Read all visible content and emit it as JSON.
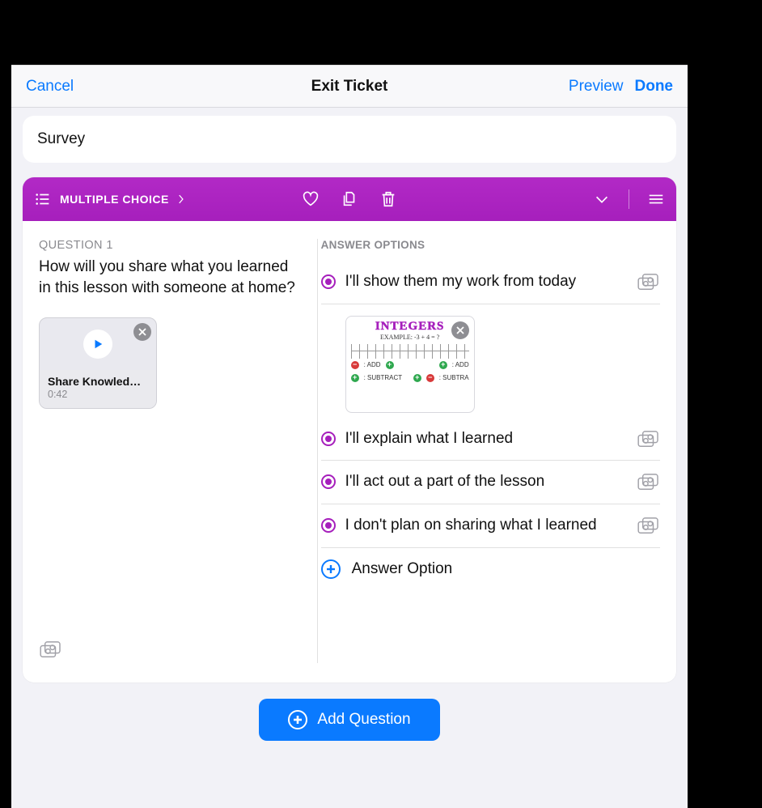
{
  "nav": {
    "cancel": "Cancel",
    "title": "Exit Ticket",
    "preview": "Preview",
    "done": "Done"
  },
  "survey_name": "Survey",
  "question": {
    "type_label": "MULTIPLE CHOICE",
    "number_label": "QUESTION 1",
    "text": "How will you share what you learned in this lesson with someone at home?",
    "attachment": {
      "name": "Share Knowled…",
      "duration": "0:42"
    }
  },
  "answers": {
    "header": "ANSWER OPTIONS",
    "options": [
      {
        "text": "I'll show them my work from today"
      },
      {
        "text": "I'll explain what I learned"
      },
      {
        "text": "I'll act out a part of the lesson"
      },
      {
        "text": "I don't plan on sharing what I learned"
      }
    ],
    "image_attachment": {
      "title": "INTEGERS",
      "subtitle": "EXAMPLE: -3 + 4 = ?",
      "chips": [
        [
          "+",
          "ADD"
        ],
        [
          "+",
          "ADD"
        ],
        [
          "-",
          "SUBTRACT"
        ],
        [
          "-",
          "SUBTRA"
        ]
      ]
    },
    "add_option": "Answer Option"
  },
  "add_question": "Add Question"
}
